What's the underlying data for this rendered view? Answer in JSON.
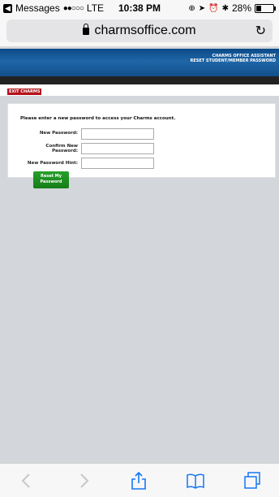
{
  "status_bar": {
    "back_app": "Messages",
    "signal": "●●○○○",
    "carrier": "LTE",
    "time": "10:38 PM",
    "battery_percent_text": "28%",
    "battery_level": 0.28
  },
  "browser": {
    "url": "charmsoffice.com"
  },
  "banner": {
    "line1": "CHARMS OFFICE ASSISTANT",
    "line2": "RESET STUDENT/MEMBER PASSWORD"
  },
  "nav": {
    "exit_label": "EXIT CHARMS"
  },
  "form": {
    "prompt": "Please enter a new password to access your Charms account.",
    "new_password_label": "New Password:",
    "confirm_label_line1": "Confirm New",
    "confirm_label_line2": "Password:",
    "hint_label": "New Password Hint:",
    "new_password_value": "",
    "confirm_value": "",
    "hint_value": "",
    "button_line1": "Reset My",
    "button_line2": "Password"
  },
  "colors": {
    "banner_blue": "#1f66a8",
    "exit_red": "#b3131b",
    "button_green": "#1f8f22"
  },
  "toolbar": {
    "icons": [
      "back-icon",
      "forward-icon",
      "share-icon",
      "bookmarks-icon",
      "tabs-icon"
    ]
  }
}
